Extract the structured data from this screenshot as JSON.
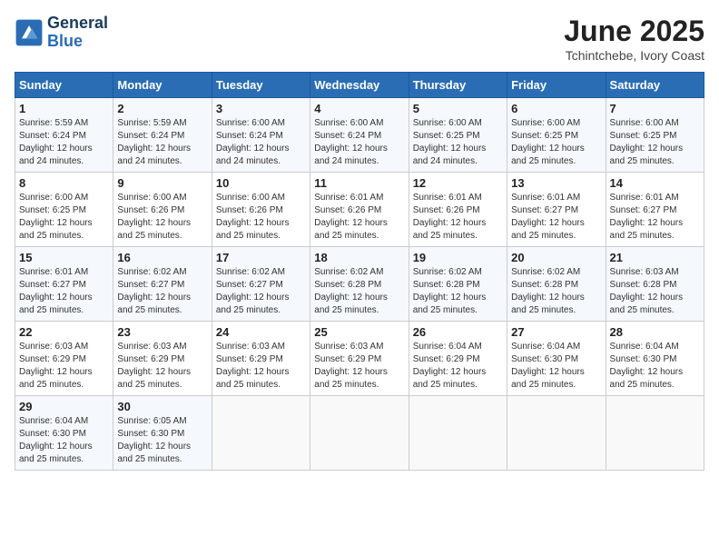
{
  "logo": {
    "line1": "General",
    "line2": "Blue"
  },
  "title": "June 2025",
  "location": "Tchintchebe, Ivory Coast",
  "weekdays": [
    "Sunday",
    "Monday",
    "Tuesday",
    "Wednesday",
    "Thursday",
    "Friday",
    "Saturday"
  ],
  "weeks": [
    [
      {
        "day": "1",
        "sunrise": "5:59 AM",
        "sunset": "6:24 PM",
        "daylight": "12 hours and 24 minutes."
      },
      {
        "day": "2",
        "sunrise": "5:59 AM",
        "sunset": "6:24 PM",
        "daylight": "12 hours and 24 minutes."
      },
      {
        "day": "3",
        "sunrise": "6:00 AM",
        "sunset": "6:24 PM",
        "daylight": "12 hours and 24 minutes."
      },
      {
        "day": "4",
        "sunrise": "6:00 AM",
        "sunset": "6:24 PM",
        "daylight": "12 hours and 24 minutes."
      },
      {
        "day": "5",
        "sunrise": "6:00 AM",
        "sunset": "6:25 PM",
        "daylight": "12 hours and 24 minutes."
      },
      {
        "day": "6",
        "sunrise": "6:00 AM",
        "sunset": "6:25 PM",
        "daylight": "12 hours and 25 minutes."
      },
      {
        "day": "7",
        "sunrise": "6:00 AM",
        "sunset": "6:25 PM",
        "daylight": "12 hours and 25 minutes."
      }
    ],
    [
      {
        "day": "8",
        "sunrise": "6:00 AM",
        "sunset": "6:25 PM",
        "daylight": "12 hours and 25 minutes."
      },
      {
        "day": "9",
        "sunrise": "6:00 AM",
        "sunset": "6:26 PM",
        "daylight": "12 hours and 25 minutes."
      },
      {
        "day": "10",
        "sunrise": "6:00 AM",
        "sunset": "6:26 PM",
        "daylight": "12 hours and 25 minutes."
      },
      {
        "day": "11",
        "sunrise": "6:01 AM",
        "sunset": "6:26 PM",
        "daylight": "12 hours and 25 minutes."
      },
      {
        "day": "12",
        "sunrise": "6:01 AM",
        "sunset": "6:26 PM",
        "daylight": "12 hours and 25 minutes."
      },
      {
        "day": "13",
        "sunrise": "6:01 AM",
        "sunset": "6:27 PM",
        "daylight": "12 hours and 25 minutes."
      },
      {
        "day": "14",
        "sunrise": "6:01 AM",
        "sunset": "6:27 PM",
        "daylight": "12 hours and 25 minutes."
      }
    ],
    [
      {
        "day": "15",
        "sunrise": "6:01 AM",
        "sunset": "6:27 PM",
        "daylight": "12 hours and 25 minutes."
      },
      {
        "day": "16",
        "sunrise": "6:02 AM",
        "sunset": "6:27 PM",
        "daylight": "12 hours and 25 minutes."
      },
      {
        "day": "17",
        "sunrise": "6:02 AM",
        "sunset": "6:27 PM",
        "daylight": "12 hours and 25 minutes."
      },
      {
        "day": "18",
        "sunrise": "6:02 AM",
        "sunset": "6:28 PM",
        "daylight": "12 hours and 25 minutes."
      },
      {
        "day": "19",
        "sunrise": "6:02 AM",
        "sunset": "6:28 PM",
        "daylight": "12 hours and 25 minutes."
      },
      {
        "day": "20",
        "sunrise": "6:02 AM",
        "sunset": "6:28 PM",
        "daylight": "12 hours and 25 minutes."
      },
      {
        "day": "21",
        "sunrise": "6:03 AM",
        "sunset": "6:28 PM",
        "daylight": "12 hours and 25 minutes."
      }
    ],
    [
      {
        "day": "22",
        "sunrise": "6:03 AM",
        "sunset": "6:29 PM",
        "daylight": "12 hours and 25 minutes."
      },
      {
        "day": "23",
        "sunrise": "6:03 AM",
        "sunset": "6:29 PM",
        "daylight": "12 hours and 25 minutes."
      },
      {
        "day": "24",
        "sunrise": "6:03 AM",
        "sunset": "6:29 PM",
        "daylight": "12 hours and 25 minutes."
      },
      {
        "day": "25",
        "sunrise": "6:03 AM",
        "sunset": "6:29 PM",
        "daylight": "12 hours and 25 minutes."
      },
      {
        "day": "26",
        "sunrise": "6:04 AM",
        "sunset": "6:29 PM",
        "daylight": "12 hours and 25 minutes."
      },
      {
        "day": "27",
        "sunrise": "6:04 AM",
        "sunset": "6:30 PM",
        "daylight": "12 hours and 25 minutes."
      },
      {
        "day": "28",
        "sunrise": "6:04 AM",
        "sunset": "6:30 PM",
        "daylight": "12 hours and 25 minutes."
      }
    ],
    [
      {
        "day": "29",
        "sunrise": "6:04 AM",
        "sunset": "6:30 PM",
        "daylight": "12 hours and 25 minutes."
      },
      {
        "day": "30",
        "sunrise": "6:05 AM",
        "sunset": "6:30 PM",
        "daylight": "12 hours and 25 minutes."
      },
      null,
      null,
      null,
      null,
      null
    ]
  ]
}
